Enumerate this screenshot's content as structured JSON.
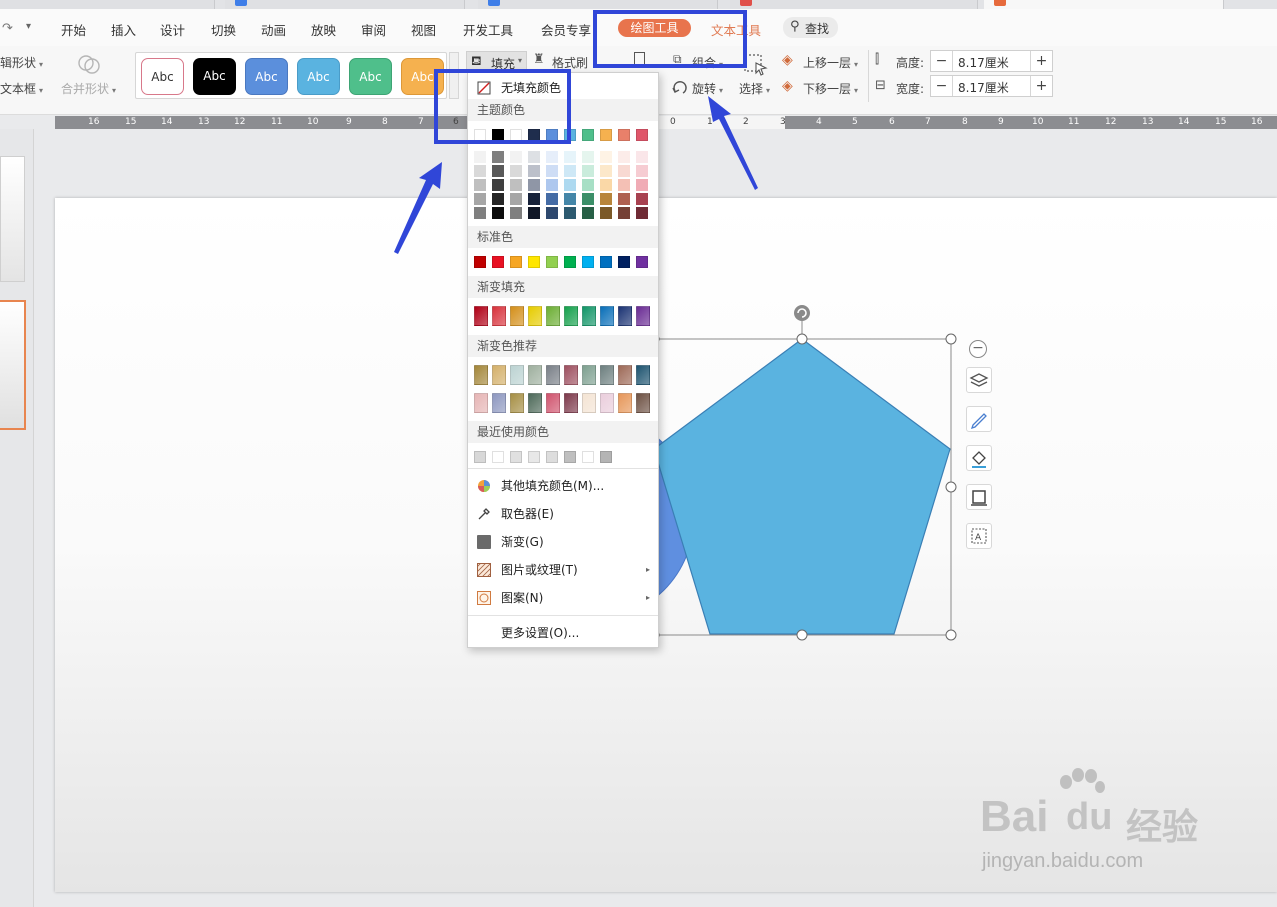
{
  "menu": {
    "items": [
      "开始",
      "插入",
      "设计",
      "切换",
      "动画",
      "放映",
      "审阅",
      "视图",
      "开发工具",
      "会员专享"
    ],
    "drawing_tools": "绘图工具",
    "text_tools": "文本工具",
    "search": "查找"
  },
  "ribbon": {
    "edit_shape": "辑形状",
    "text_box": "文本框",
    "merge_shape": "合并形状",
    "style_samples": [
      "Abc",
      "Abc",
      "Abc",
      "Abc",
      "Abc",
      "Abc"
    ],
    "fill": "填充",
    "format_painter": "格式刷",
    "group": "组合",
    "rotate": "旋转",
    "select": "选择",
    "bring_forward": "上移一层",
    "send_backward": "下移一层",
    "height_label": "高度:",
    "height_value": "8.17厘米",
    "width_label": "宽度:",
    "width_value": "8.17厘米"
  },
  "ruler": {
    "left_ticks": [
      "16",
      "15",
      "14",
      "13",
      "12",
      "11",
      "10",
      "9",
      "8",
      "7",
      "6"
    ],
    "mid_ticks": [
      "0",
      "1",
      "2"
    ],
    "right_ticks": [
      "3",
      "4",
      "5",
      "6",
      "7",
      "8",
      "9",
      "10",
      "11",
      "12",
      "13",
      "14",
      "15",
      "16"
    ]
  },
  "fill_dropdown": {
    "no_fill": "无填充颜色",
    "theme_colors": "主题颜色",
    "standard_colors": "标准色",
    "gradient_fill": "渐变填充",
    "gradient_recommend": "渐变色推荐",
    "recent_colors": "最近使用颜色",
    "items": [
      {
        "label": "其他填充颜色(M)...",
        "icon": "color-wheel-icon"
      },
      {
        "label": "取色器(E)",
        "icon": "eyedropper-icon"
      },
      {
        "label": "渐变(G)",
        "icon": "gradient-icon"
      },
      {
        "label": "图片或纹理(T)",
        "icon": "texture-icon",
        "submenu": true
      },
      {
        "label": "图案(N)",
        "icon": "pattern-icon",
        "submenu": true
      },
      {
        "label": "更多设置(O)...",
        "icon": ""
      }
    ],
    "theme_row": [
      "#ffffff",
      "#000000",
      "#ffffff",
      "#1f2d4d",
      "#5b8fdc",
      "#5ab3e0",
      "#4fbf8b",
      "#f5b14f",
      "#e9806a",
      "#e0566a"
    ],
    "standard_row": [
      "#c00000",
      "#e81123",
      "#f6a623",
      "#ffe600",
      "#92d050",
      "#00b050",
      "#00b0f0",
      "#0070c0",
      "#002060",
      "#7030a0"
    ],
    "gradient_row": [
      "#b00016",
      "#d8333c",
      "#d4901c",
      "#e6cc00",
      "#6cae34",
      "#16a14d",
      "#139668",
      "#0a6fb8",
      "#1c3474",
      "#6a2c94"
    ],
    "recommend_row1": [
      "#a4873a",
      "#d4b06a",
      "#bcd3d2",
      "#9fb09f",
      "#7a8088",
      "#9e5060",
      "#7ea090",
      "#6e8080",
      "#9e6a58",
      "#1e5470"
    ],
    "recommend_row2": [
      "#e6b5b5",
      "#8e98c0",
      "#a68f45",
      "#4e6a5a",
      "#d0546e",
      "#7e3a4c",
      "#f4e4d4",
      "#eacedc",
      "#e6975a",
      "#6e5244"
    ],
    "recent_row": [
      "#d8d8d8",
      "#ffffff",
      "#e0e0e0",
      "#e8e8e8",
      "#dddddd",
      "#bfbfbf",
      "#ffffff",
      "#b4b4b4"
    ]
  },
  "colors": {
    "accent": "#e8744d",
    "pentagon": "#5ab3e0",
    "circle": "#5f8fe0",
    "annotation": "#3046d8"
  },
  "watermark": {
    "brand": "Bai",
    "brand2": "du",
    "suffix": "经验",
    "url": "jingyan.baidu.com"
  }
}
